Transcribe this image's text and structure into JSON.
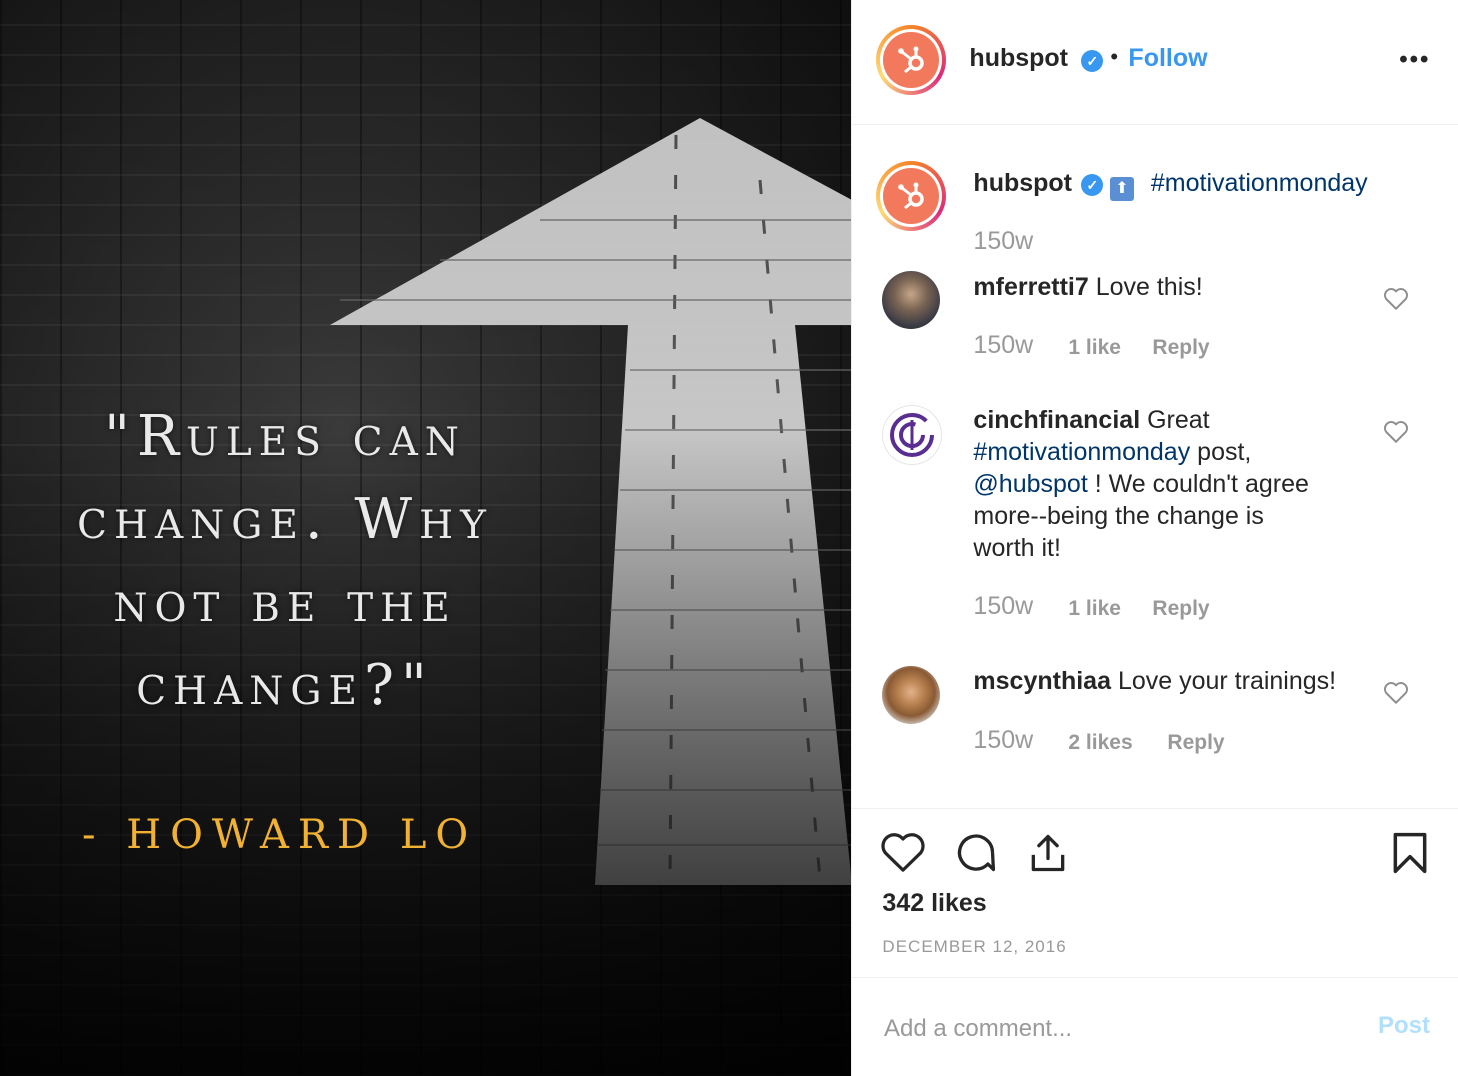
{
  "image": {
    "quote": "\"Rules can change. Why not be the change?\"",
    "author": "- HOWARD LO"
  },
  "header": {
    "username": "hubspot",
    "separator": "•",
    "follow_label": "Follow",
    "more_label": "•••"
  },
  "caption": {
    "username": "hubspot",
    "emoji": "⬆",
    "hashtag": "#motivationmonday",
    "time": "150w"
  },
  "comments": [
    {
      "username": "mferretti7",
      "text": "Love this!",
      "time": "150w",
      "likes": "1 like",
      "reply": "Reply"
    },
    {
      "username": "cinchfinancial",
      "text_1": "Great",
      "hashtag": "#motivationmonday",
      "text_2": "post,",
      "mention": "@hubspot",
      "text_3": "! We couldn't agree",
      "text_4": "more--being the change is",
      "text_5": "worth it!",
      "time": "150w",
      "likes": "1 like",
      "reply": "Reply"
    },
    {
      "username": "mscynthiaa",
      "text": "Love your trainings!",
      "time": "150w",
      "likes": "2 likes",
      "reply": "Reply"
    }
  ],
  "actions": {
    "likes": "342 likes",
    "date": "DECEMBER 12, 2016"
  },
  "comment_box": {
    "placeholder": "Add a comment...",
    "post_label": "Post"
  },
  "colors": {
    "brand": "#f2795b",
    "link": "#3897f0",
    "hashtag": "#003569",
    "author_text": "#f1b233"
  }
}
